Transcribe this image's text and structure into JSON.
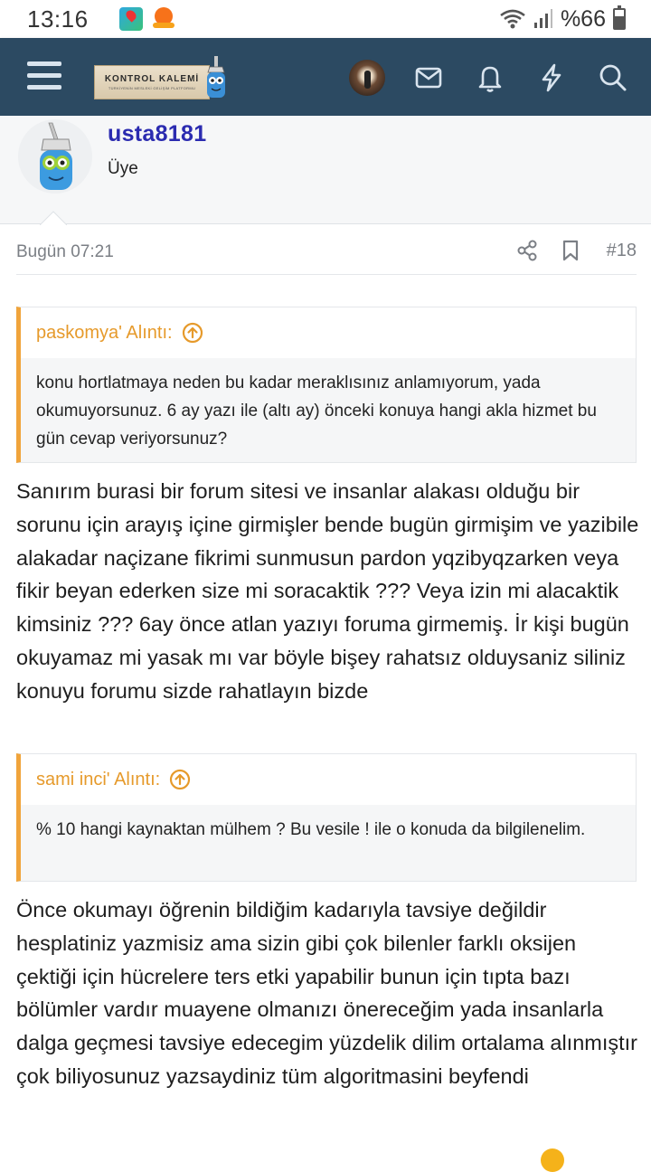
{
  "status_bar": {
    "time": "13:16",
    "battery": "%66"
  },
  "navbar": {
    "logo_title": "KONTROL KALEMİ",
    "logo_subtitle": "TÜRKİYENİN MESLEKİ GELİŞİM PLATFORMU"
  },
  "member": {
    "name": "usta8181",
    "title": "Üye"
  },
  "post": {
    "date": "Bugün 07:21",
    "number": "#18"
  },
  "quotes": [
    {
      "author": "paskomya' Alıntı:",
      "text": "konu hortlatmaya neden bu kadar meraklısınız anlamıyorum, yada okumuyorsunuz. 6 ay yazı ile (altı ay) önceki konuya hangi akla hizmet bu gün cevap veriyorsunuz?"
    },
    {
      "author": "sami inci' Alıntı:",
      "text": "% 10 hangi kaynaktan mülhem ? Bu vesile ! ile o konuda da bilgilenelim."
    }
  ],
  "replies": [
    "Sanırım burasi bir forum sitesi ve insanlar alakası olduğu bir sorunu için arayış içine girmişler bende bugün girmişim ve yazibile alakadar naçizane fikrimi sunmusun pardon yqzibyqzarken veya fikir beyan ederken size mi soracaktik ??? Veya izin mi alacaktik kimsiniz ??? 6ay önce atlan yazıyı foruma girmemiş. İr kişi bugün okuyamaz mi yasak mı var böyle bişey rahatsız olduysaniz siliniz konuyu forumu sizde rahatlayın bizde",
    "Önce okumayı öğrenin bildiğim kadarıyla tavsiye değildir hesplatiniz yazmisiz ama sizin gibi çok bilenler farklı oksijen çektiği için hücrelere ters etki yapabilir bunun için tıpta bazı bölümler vardır muayene olmanızı önereceğim yada insanlarla dalga geçmesi tavsiye edecegim yüzdelik dilim ortalama alınmıştır çok biliyosunuz yazsaydiniz tüm algoritmasini beyfendi"
  ],
  "colors": {
    "navbar": "#2c4a62",
    "username": "#2b2bb0",
    "quote_accent": "#f0a43b"
  }
}
